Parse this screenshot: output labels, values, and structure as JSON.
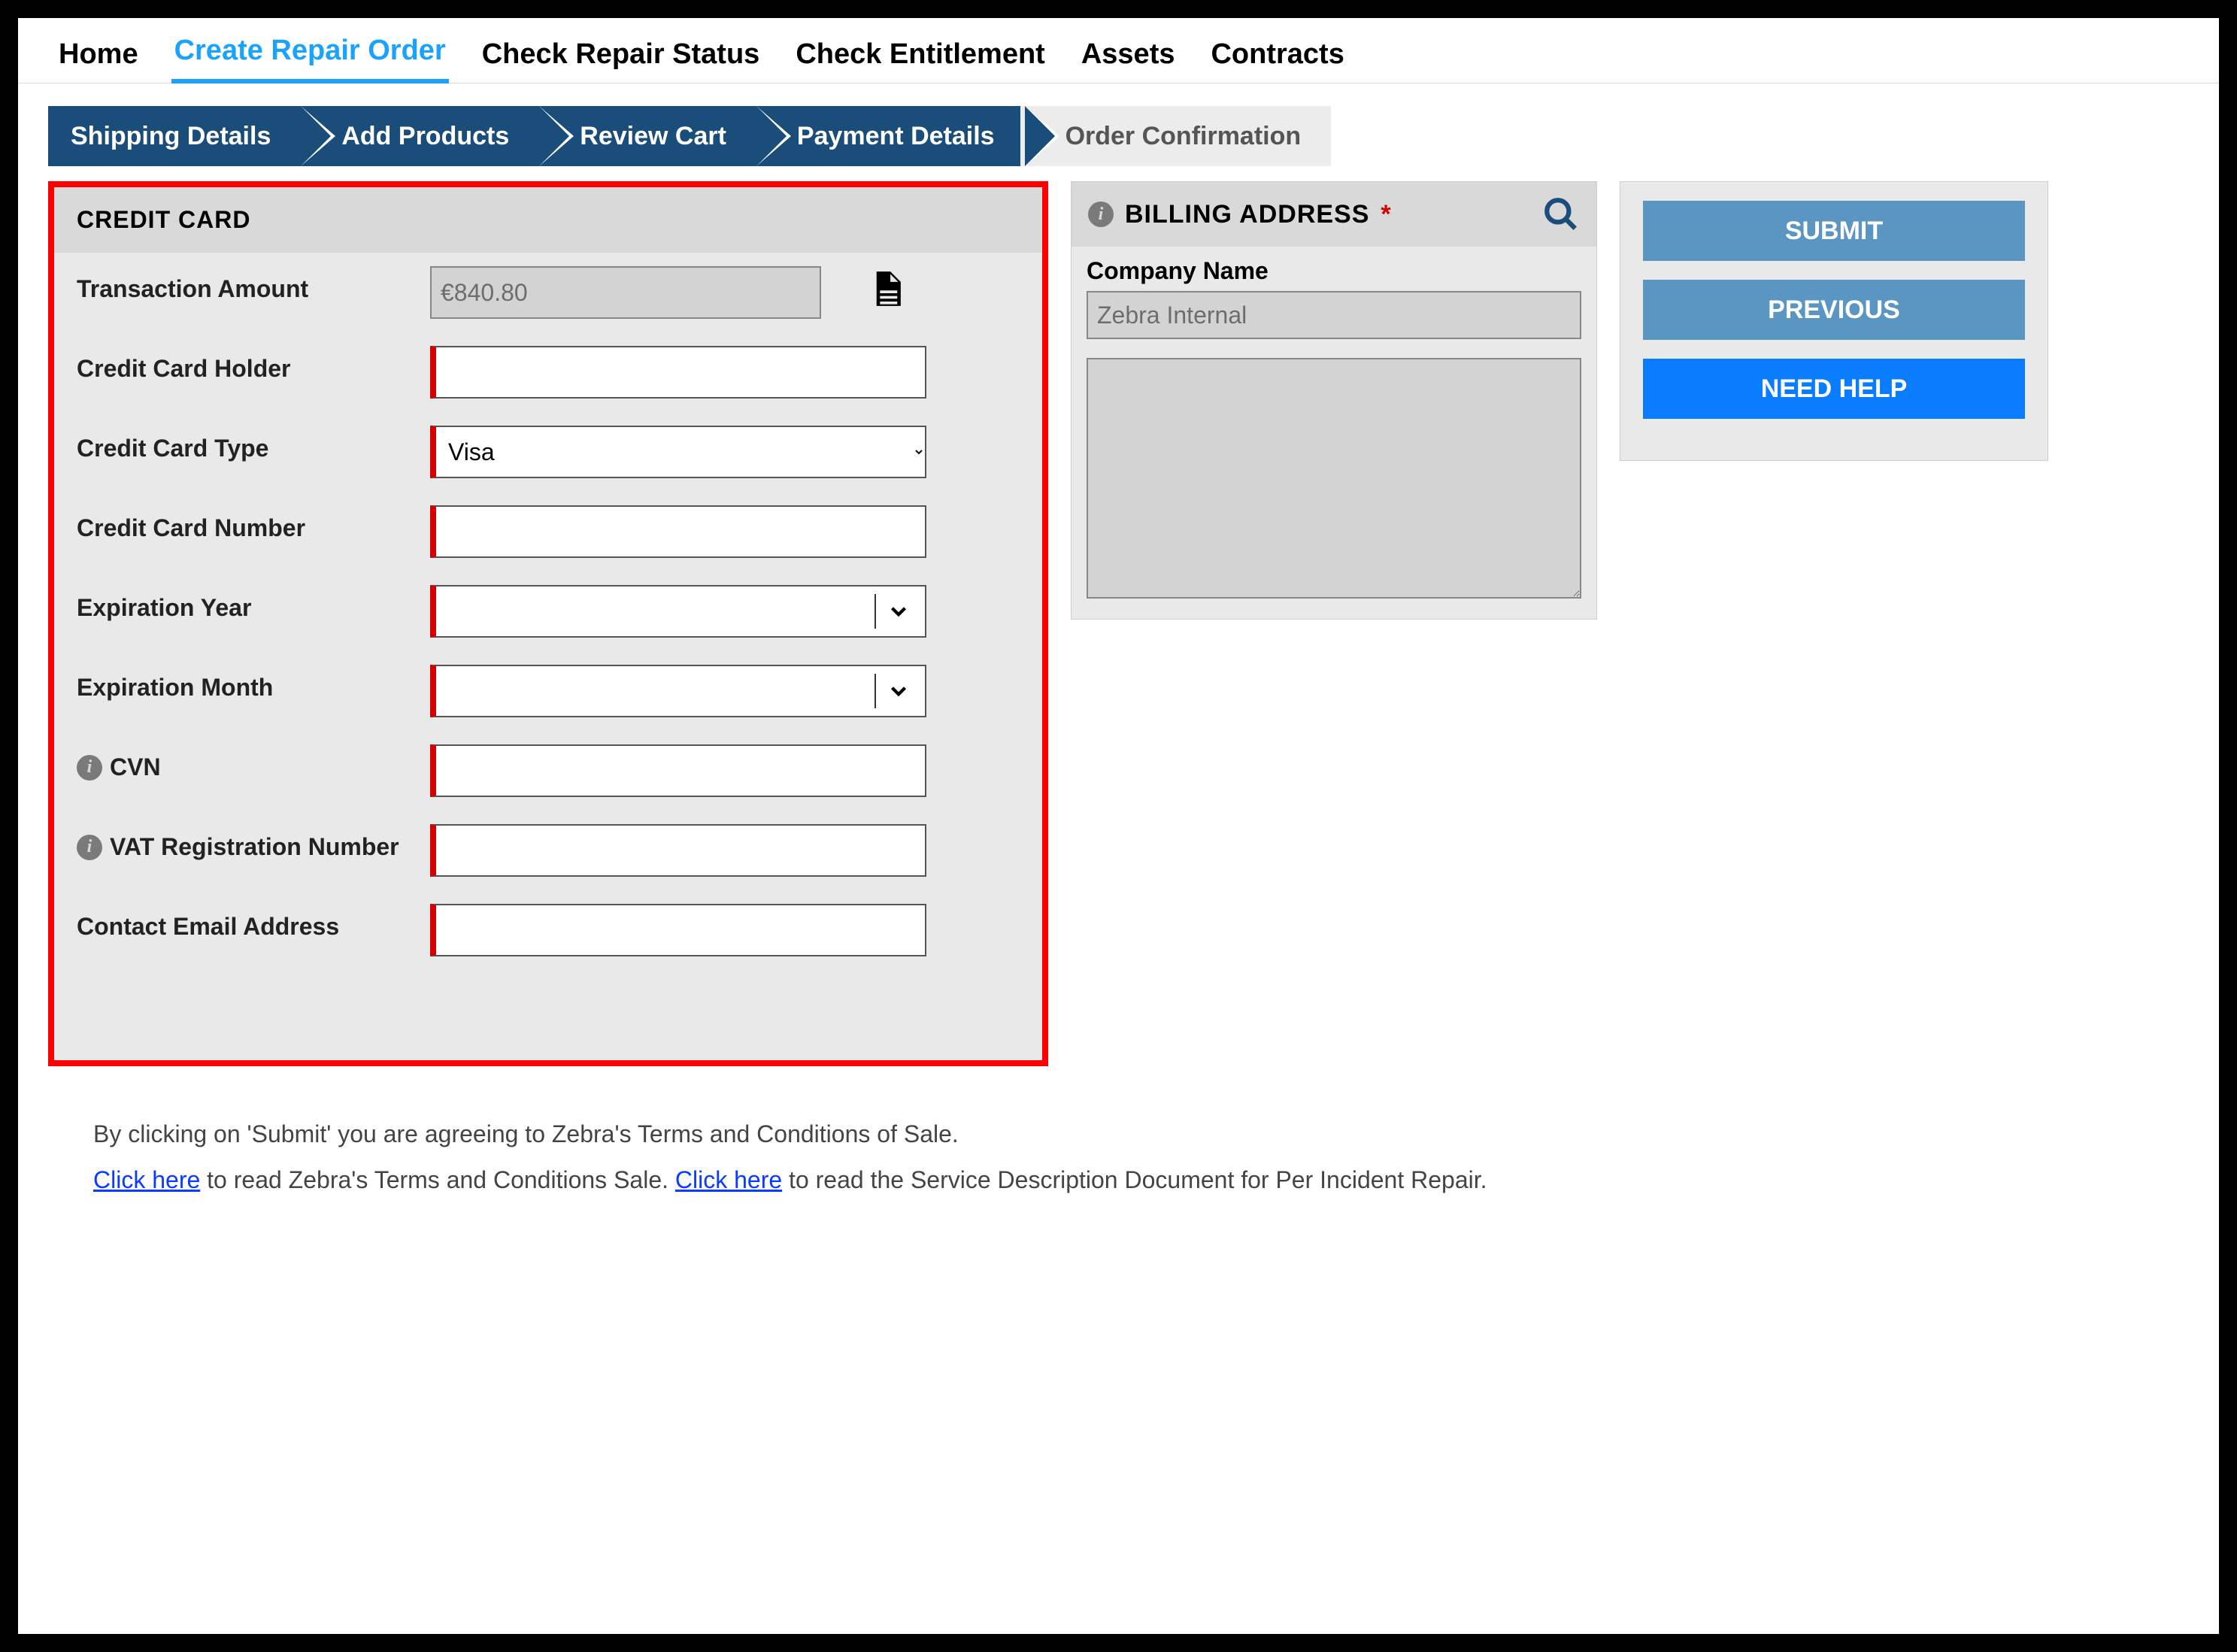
{
  "topnav": {
    "items": [
      "Home",
      "Create Repair Order",
      "Check Repair Status",
      "Check Entitlement",
      "Assets",
      "Contracts"
    ],
    "active_index": 1
  },
  "steps": {
    "items": [
      "Shipping Details",
      "Add Products",
      "Review Cart",
      "Payment Details",
      "Order Confirmation"
    ],
    "active_index": 3
  },
  "credit": {
    "header": "CREDIT CARD",
    "labels": {
      "amount": "Transaction Amount",
      "holder": "Credit Card Holder",
      "type": "Credit Card Type",
      "number": "Credit Card Number",
      "exp_year": "Expiration Year",
      "exp_month": "Expiration Month",
      "cvn": "CVN",
      "vat": "VAT Registration Number",
      "email": "Contact Email Address"
    },
    "values": {
      "amount": "€840.80",
      "holder": "",
      "type": "Visa",
      "number": "",
      "exp_year": "",
      "exp_month": "",
      "cvn": "",
      "vat": "",
      "email": ""
    }
  },
  "billing": {
    "header": "BILLING ADDRESS",
    "company_label": "Company Name",
    "company_value": "Zebra Internal",
    "address_value": ""
  },
  "actions": {
    "submit": "SUBMIT",
    "previous": "PREVIOUS",
    "need_help": "NEED HELP"
  },
  "legal": {
    "line1_pre": "By clicking on 'Submit' you are agreeing to Zebra's Terms and Conditions of Sale.",
    "link1": "Click here",
    "line2_mid1": " to read Zebra's Terms and Conditions Sale. ",
    "link2": "Click here",
    "line2_mid2": " to read the Service Description Document for Per Incident Repair."
  }
}
